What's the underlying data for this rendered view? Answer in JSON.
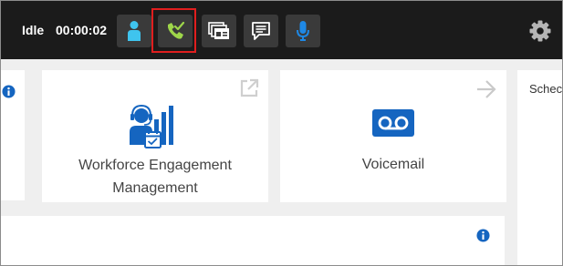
{
  "status": {
    "state": "Idle",
    "timer": "00:00:02"
  },
  "toolbar": {
    "buttons": [
      {
        "name": "agent",
        "icon": "person-icon"
      },
      {
        "name": "calls",
        "icon": "phone-check-icon",
        "highlighted": true
      },
      {
        "name": "media",
        "icon": "windows-icon"
      },
      {
        "name": "chat",
        "icon": "chat-icon"
      },
      {
        "name": "mic",
        "icon": "microphone-icon"
      }
    ],
    "settings_icon": "gear-icon"
  },
  "cards": {
    "wem": {
      "title": "Workforce Engagement\nManagement",
      "corner_icon": "external-link-icon",
      "icon": "workforce-engagement-icon"
    },
    "voicemail": {
      "title": "Voicemail",
      "corner_icon": "arrow-right-icon",
      "icon": "voicemail-icon"
    },
    "schedule": {
      "label": "Schec"
    }
  },
  "colors": {
    "topbar": "#1b1b1b",
    "button_bg": "#3a3a3a",
    "accent_blue": "#1565c0",
    "agent_cyan": "#3fc4ee",
    "call_green": "#9ed64a",
    "highlight_red": "#e01e1e"
  }
}
